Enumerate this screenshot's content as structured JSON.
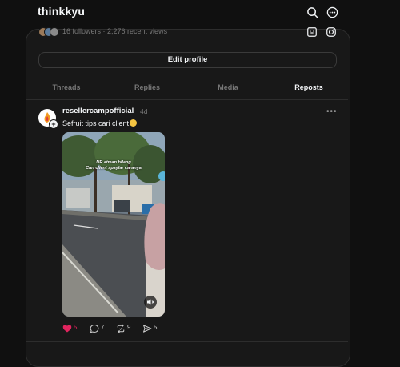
{
  "header": {
    "username": "thinkkyu"
  },
  "profile": {
    "meta": "16 followers · 2,276 recent views",
    "edit_label": "Edit profile"
  },
  "tabs": [
    {
      "label": "Threads"
    },
    {
      "label": "Replies"
    },
    {
      "label": "Media"
    },
    {
      "label": "Reposts"
    }
  ],
  "active_tab": "Reposts",
  "post": {
    "username": "resellercampofficial",
    "time": "4d",
    "caption": "Sefruit tips cari client",
    "overlay_line1": "NR atman bilang",
    "overlay_line2": "Cari client spaylar caranya",
    "likes": "5",
    "replies": "7",
    "reposts": "9",
    "shares": "5"
  },
  "colors": {
    "background": "#101010",
    "panel": "#181818",
    "like": "#e0245e"
  },
  "icons": {
    "search": "search-icon",
    "menu": "more-circle-icon",
    "insights": "insights-icon",
    "instagram": "instagram-icon"
  }
}
